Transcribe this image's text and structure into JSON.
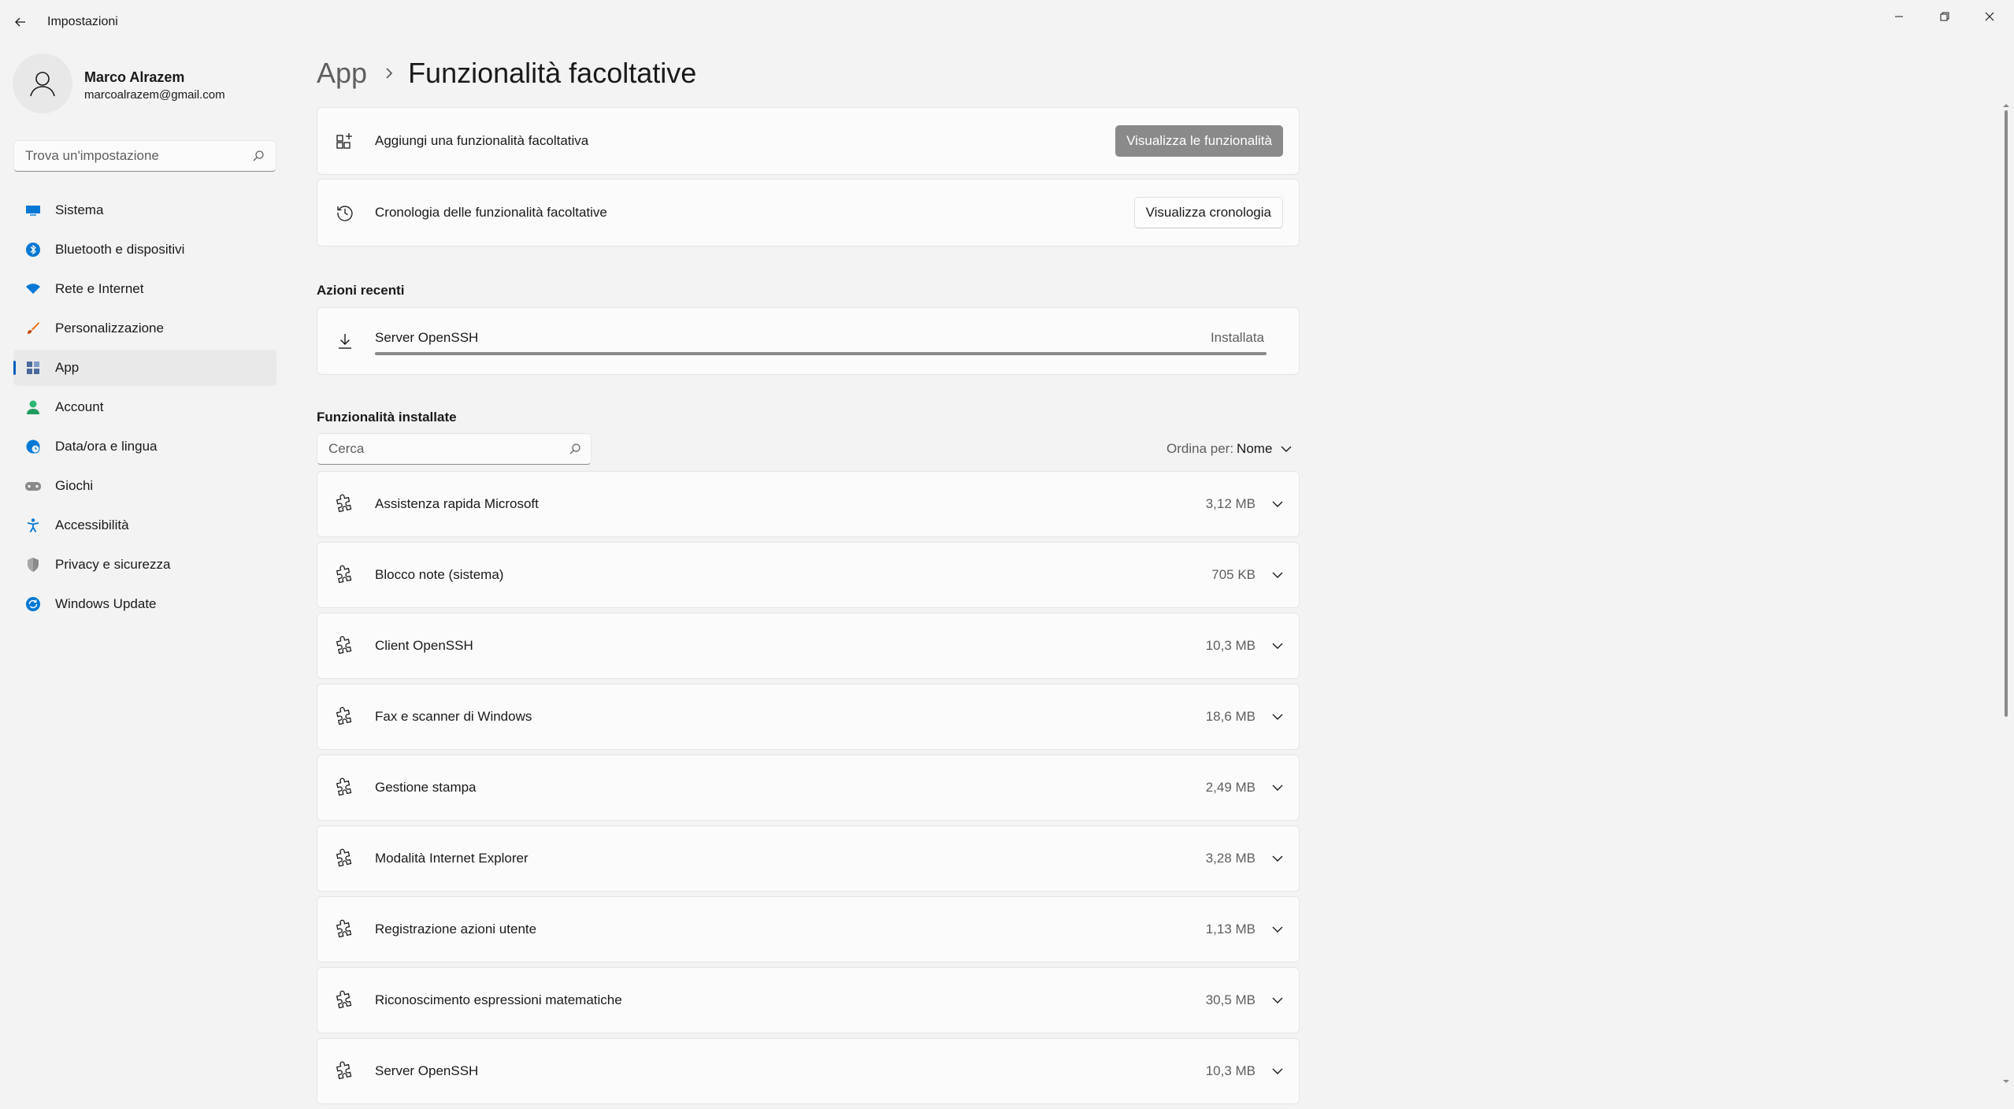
{
  "window": {
    "title": "Impostazioni",
    "controls": [
      "minimize-icon",
      "restore-icon",
      "close-icon"
    ]
  },
  "profile": {
    "name": "Marco Alrazem",
    "email": "marcoalrazem@gmail.com"
  },
  "sidebar": {
    "search_placeholder": "Trova un'impostazione",
    "items": [
      {
        "label": "Sistema",
        "icon": "monitor-icon",
        "color": "#0078d4"
      },
      {
        "label": "Bluetooth e dispositivi",
        "icon": "bluetooth-icon",
        "color": "#0078d4"
      },
      {
        "label": "Rete e Internet",
        "icon": "wifi-icon",
        "color": "#0078d4"
      },
      {
        "label": "Personalizzazione",
        "icon": "brush-icon",
        "color": "#e8700c"
      },
      {
        "label": "App",
        "icon": "apps-icon",
        "color": "#4a6a9c",
        "active": true
      },
      {
        "label": "Account",
        "icon": "person-icon",
        "color": "#2bb673"
      },
      {
        "label": "Data/ora e lingua",
        "icon": "globe-clock-icon",
        "color": "#0078d4"
      },
      {
        "label": "Giochi",
        "icon": "gamepad-icon",
        "color": "#767676"
      },
      {
        "label": "Accessibilità",
        "icon": "accessibility-icon",
        "color": "#0078d4"
      },
      {
        "label": "Privacy e sicurezza",
        "icon": "shield-icon",
        "color": "#767676"
      },
      {
        "label": "Windows Update",
        "icon": "update-icon",
        "color": "#0078d4"
      }
    ]
  },
  "breadcrumb": {
    "parent": "App",
    "current": "Funzionalità facoltative"
  },
  "add_card": {
    "label": "Aggiungi una funzionalità facoltativa",
    "button": "Visualizza le funzionalità"
  },
  "history_card": {
    "label": "Cronologia delle funzionalità facoltative",
    "button": "Visualizza cronologia"
  },
  "recent": {
    "title": "Azioni recenti",
    "item": {
      "name": "Server OpenSSH",
      "status": "Installata",
      "progress": 1.0
    }
  },
  "installed": {
    "title": "Funzionalità installate",
    "search_placeholder": "Cerca",
    "sort_label": "Ordina per:",
    "sort_value": "Nome",
    "items": [
      {
        "name": "Assistenza rapida Microsoft",
        "size": "3,12 MB"
      },
      {
        "name": "Blocco note (sistema)",
        "size": "705 KB"
      },
      {
        "name": "Client OpenSSH",
        "size": "10,3 MB"
      },
      {
        "name": "Fax e scanner di Windows",
        "size": "18,6 MB"
      },
      {
        "name": "Gestione stampa",
        "size": "2,49 MB"
      },
      {
        "name": "Modalità Internet Explorer",
        "size": "3,28 MB"
      },
      {
        "name": "Registrazione azioni utente",
        "size": "1,13 MB"
      },
      {
        "name": "Riconoscimento espressioni matematiche",
        "size": "30,5 MB"
      },
      {
        "name": "Server OpenSSH",
        "size": "10,3 MB"
      }
    ]
  }
}
